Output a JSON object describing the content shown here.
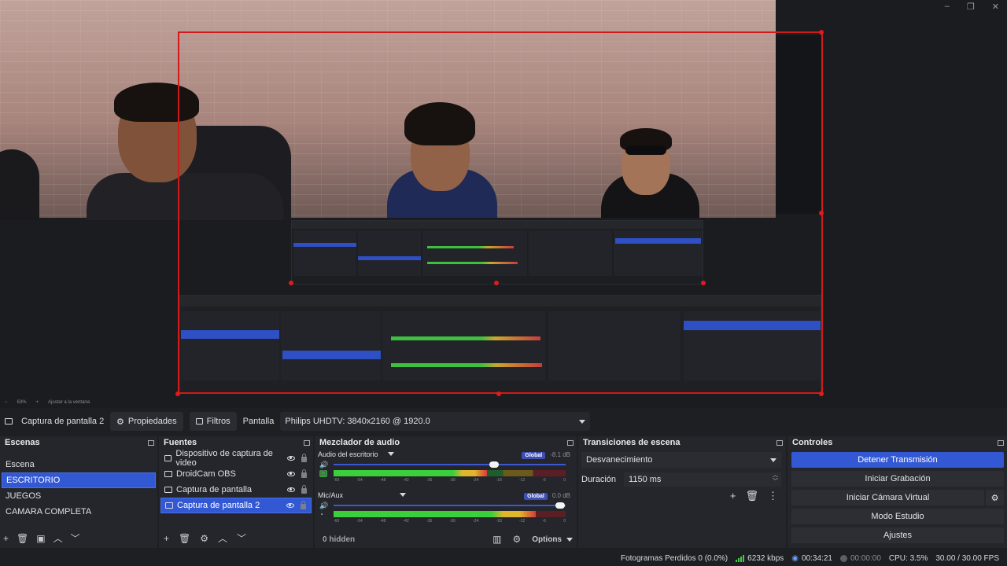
{
  "window": {
    "controls": [
      "–",
      "❐",
      "✕"
    ]
  },
  "zoom_bar": {
    "zoom": "63%",
    "fit_label": "Ajustar a la ventana"
  },
  "source_bar": {
    "source_name": "Captura de pantalla 2",
    "properties_label": "Propiedades",
    "filters_label": "Filtros",
    "display_label": "Pantalla",
    "display_value": "Philips UHDTV: 3840x2160 @ 1920.0"
  },
  "scenes": {
    "title": "Escenas",
    "items": [
      "Escena",
      "ESCRITORIO",
      "JUEGOS",
      "CAMARA COMPLETA"
    ],
    "selected_index": 1
  },
  "sources": {
    "title": "Fuentes",
    "items": [
      "Dispositivo de captura de video",
      "DroidCam OBS",
      "Captura de pantalla",
      "Captura de pantalla 2"
    ],
    "selected_index": 3
  },
  "mixer": {
    "title": "Mezclador de audio",
    "channels": [
      {
        "name": "Audio del escritorio",
        "badge": "Global",
        "db": "-8.1 dB",
        "volume": 0.69,
        "level": 0.66
      },
      {
        "name": "Mic/Aux",
        "badge": "Global",
        "db": "0.0 dB",
        "volume": 0.96,
        "level": 0.87
      }
    ],
    "ticks": [
      "-60",
      "-54",
      "-48",
      "-42",
      "-36",
      "-30",
      "-24",
      "-18",
      "-12",
      "-6",
      "0"
    ],
    "hidden_label": "0 hidden",
    "options_label": "Options"
  },
  "transitions": {
    "title": "Transiciones de escena",
    "selected": "Desvanecimiento",
    "duration_label": "Duración",
    "duration_value": "1150 ms"
  },
  "controls": {
    "title": "Controles",
    "buttons": [
      "Detener Transmisión",
      "Iniciar Grabación",
      "Iniciar Cámara Virtual",
      "Modo Estudio",
      "Ajustes"
    ]
  },
  "status": {
    "dropped": "Fotogramas Perdidos 0 (0.0%)",
    "bitrate": "6232 kbps",
    "stream_time": "00:34:21",
    "rec_time": "00:00:00",
    "cpu": "CPU: 3.5%",
    "fps": "30.00 / 30.00 FPS"
  },
  "colors": {
    "accent": "#3358d4",
    "live_red": "#d11a1a",
    "meter_green": "#3ccf3c"
  }
}
